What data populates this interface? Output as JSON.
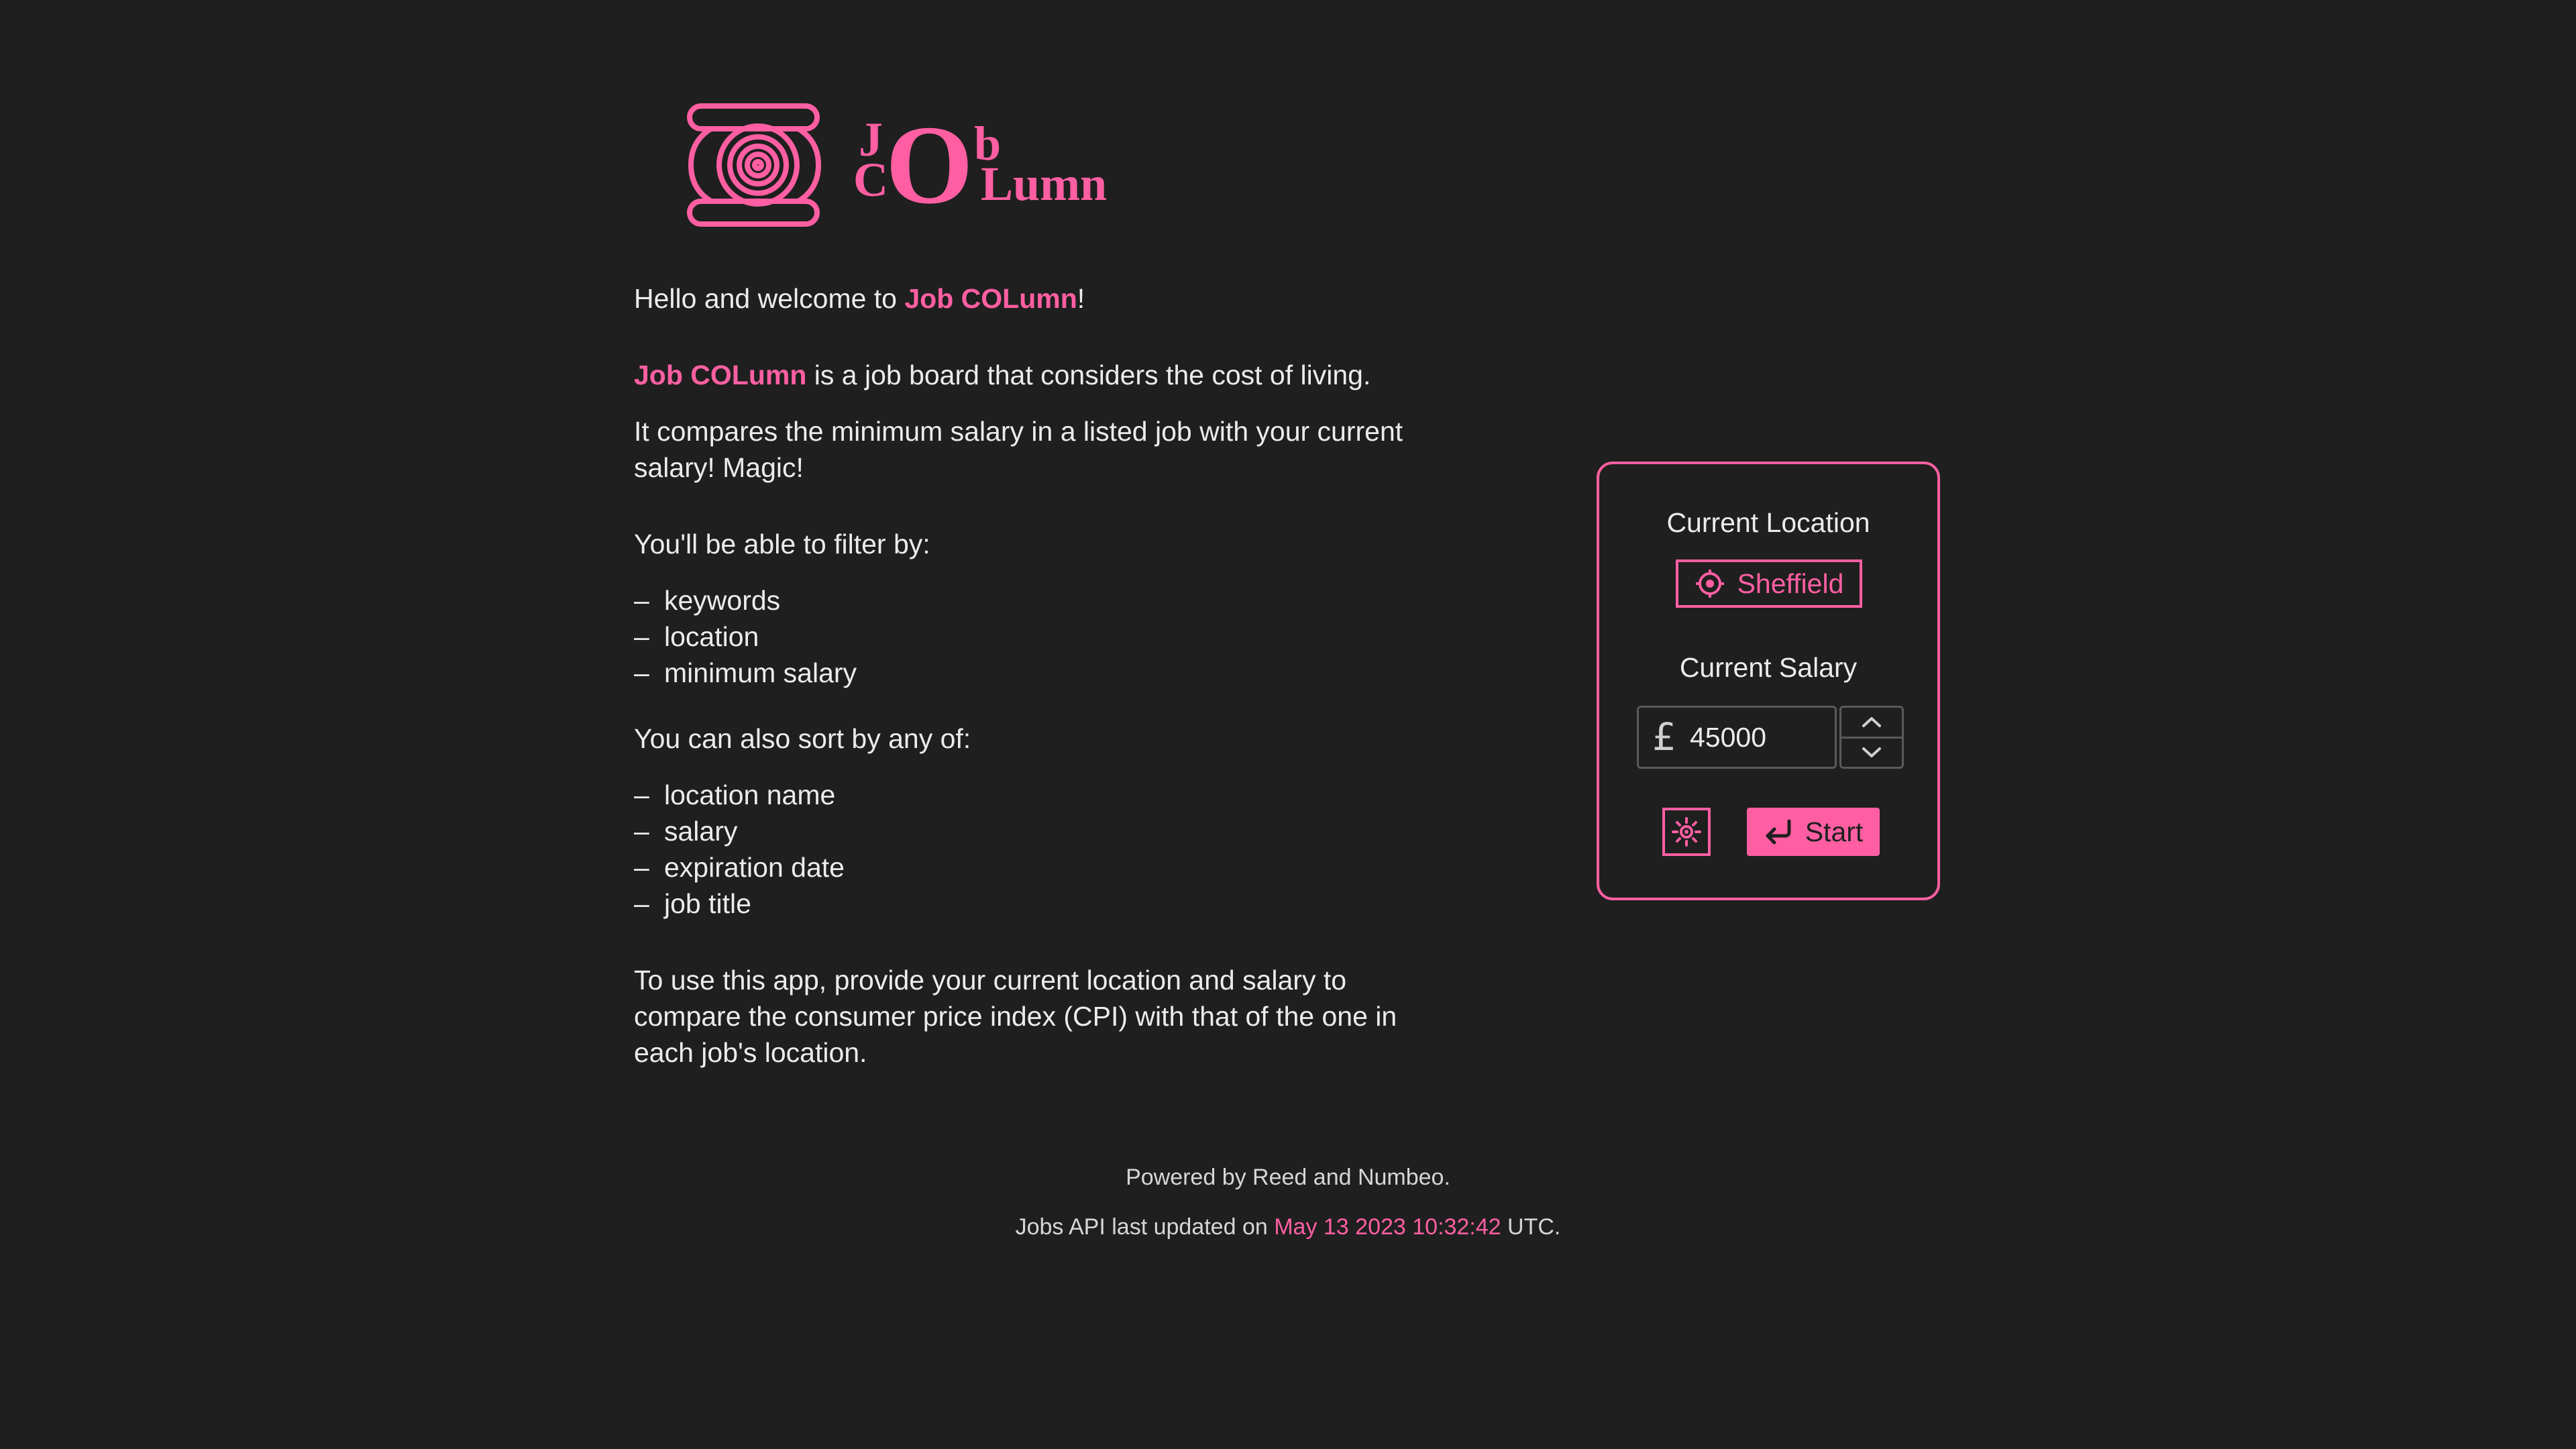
{
  "brand": {
    "name": "Job COLumn",
    "logo_letters": {
      "j": "J",
      "c": "C",
      "o": "O",
      "b": "b",
      "lumn": "Lumn"
    },
    "accent_color": "#ff5fa2",
    "background_color": "#1f1f1f"
  },
  "intro": {
    "hello_prefix": "Hello and welcome to ",
    "hello_suffix": "!",
    "board_suffix": " is a job board that considers the cost of living.",
    "compare_text": "It compares the minimum salary in a listed job with your current salary! Magic!",
    "filter_heading": "You'll be able to filter by:",
    "filters": [
      "keywords",
      "location",
      "minimum salary"
    ],
    "sort_heading": "You can also sort by any of:",
    "sorts": [
      "location name",
      "salary",
      "expiration date",
      "job title"
    ],
    "usage_text": "To use this app, provide your current location and salary to compare the consumer price index (CPI) with that of the one in each job's location."
  },
  "form": {
    "location_label": "Current Location",
    "location_value": "Sheffield",
    "location_icon": "crosshair-icon",
    "salary_label": "Current Salary",
    "currency_symbol": "£",
    "salary_value": "45000",
    "theme_icon": "sun-icon",
    "start_label": "Start",
    "start_icon": "enter-arrow-icon"
  },
  "footer": {
    "powered_by": "Powered by Reed and Numbeo.",
    "api_prefix": "Jobs API last updated on ",
    "api_timestamp": "May 13 2023 10:32:42",
    "api_suffix": " UTC."
  }
}
